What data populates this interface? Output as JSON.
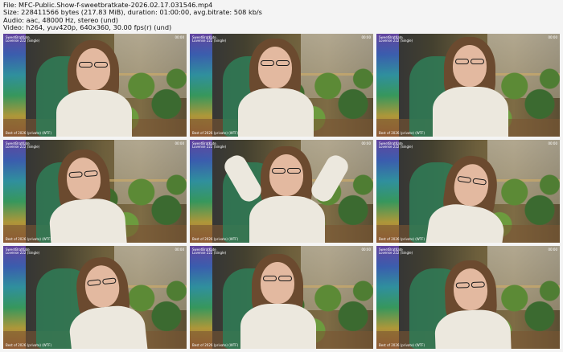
{
  "header": {
    "line1": "File: MFC-Public.Show-f-sweetbratkate-2026.02.17.031546.mp4",
    "line2": "Size: 228411566 bytes (217.83 MiB), duration: 01:00:00, avg.bitrate: 508 kb/s",
    "line3": "Audio: aac, 48000 Hz, stereo (und)",
    "line4": "Video: h264, yuv420p, 640x360, 30.00 fps(r) (und)"
  },
  "thumbnails": [
    {
      "overlay_tl": "SweetBratKate\nLovense 222 (Single)",
      "overlay_bl": "Best of 2026 (private) (WTF)",
      "overlay_tr": "00:00"
    },
    {
      "overlay_tl": "SweetBratKate\nLovense 222 (Single)",
      "overlay_bl": "Best of 2026 (private) (WTF)",
      "overlay_tr": "00:00"
    },
    {
      "overlay_tl": "SweetBratKate\nLovense 222 (Single)",
      "overlay_bl": "Best of 2026 (private) (WTF)",
      "overlay_tr": "00:00"
    },
    {
      "overlay_tl": "SweetBratKate\nLovense 222 (Single)",
      "overlay_bl": "Best of 2026 (private) (WTF)",
      "overlay_tr": "00:00"
    },
    {
      "overlay_tl": "SweetBratKate\nLovense 222 (Single)",
      "overlay_bl": "Best of 2026 (private) (WTF)",
      "overlay_tr": "00:00"
    },
    {
      "overlay_tl": "SweetBratKate\nLovense 222 (Single)",
      "overlay_bl": "Best of 2026 (private) (WTF)",
      "overlay_tr": "00:00"
    },
    {
      "overlay_tl": "SweetBratKate\nLovense 222 (Single)",
      "overlay_bl": "Best of 2026 (private) (WTF)",
      "overlay_tr": "00:00"
    },
    {
      "overlay_tl": "SweetBratKate\nLovense 222 (Single)",
      "overlay_bl": "Best of 2026 (private) (WTF)",
      "overlay_tr": "00:00"
    },
    {
      "overlay_tl": "SweetBratKate\nLovense 222 (Single)",
      "overlay_bl": "Best of 2026 (private) (WTF)",
      "overlay_tr": "00:00"
    }
  ],
  "colors": {
    "background": "#f4f4f4",
    "text": "#111111",
    "chair": "#2f7d57",
    "cardigan": "#ece8de",
    "hair": "#6b4a2f"
  }
}
